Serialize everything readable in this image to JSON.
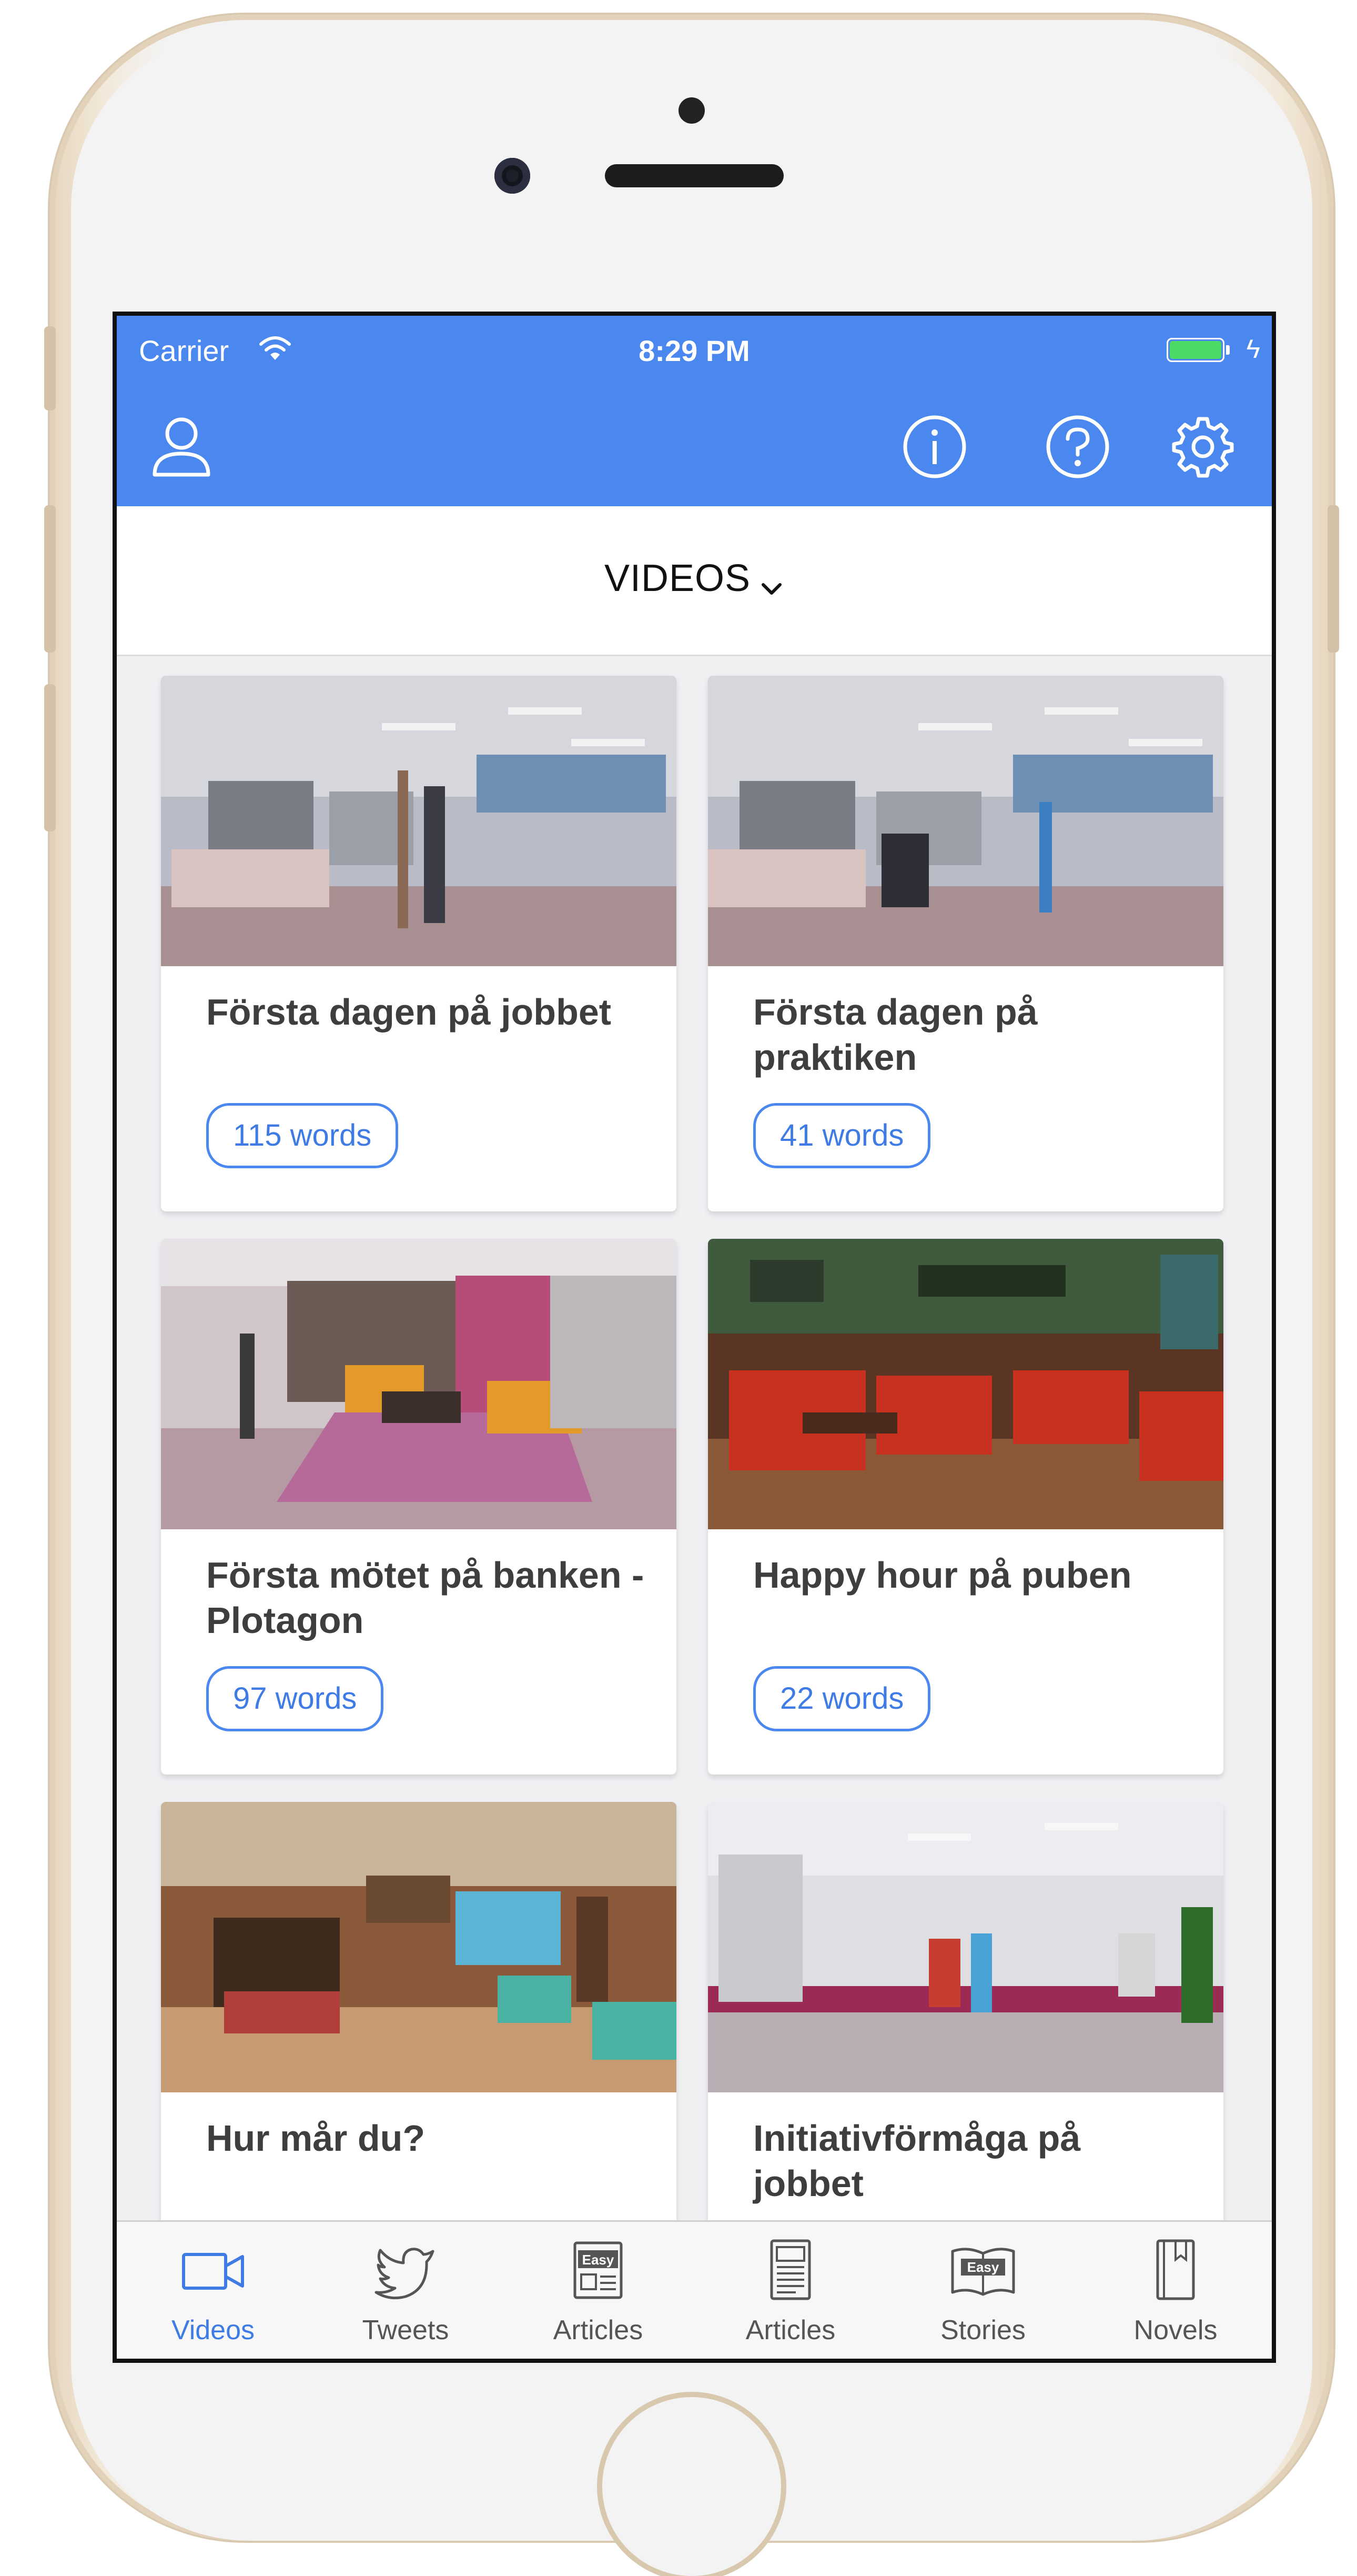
{
  "status_bar": {
    "carrier": "Carrier",
    "time": "8:29 PM",
    "battery_color": "#4cd964"
  },
  "nav_bar": {
    "color": "#4a88ef",
    "icons": [
      "user-icon",
      "info-icon",
      "help-icon",
      "gear-icon"
    ]
  },
  "page": {
    "title": "VIDEOS"
  },
  "cards": [
    {
      "title": "Första dagen på jobbet",
      "badge": "115 words"
    },
    {
      "title": "Första dagen på praktiken",
      "badge": "41 words"
    },
    {
      "title": "Första mötet på banken - Plotagon",
      "badge": "97 words"
    },
    {
      "title": "Happy hour på puben",
      "badge": "22 words"
    },
    {
      "title": "Hur mår du?"
    },
    {
      "title": "Initiativförmåga på jobbet"
    }
  ],
  "tabs": [
    {
      "label": "Videos",
      "icon": "video-camera-icon",
      "active": true
    },
    {
      "label": "Tweets",
      "icon": "twitter-bird-icon",
      "active": false
    },
    {
      "label": "Articles",
      "icon": "easy-articles-icon",
      "active": false
    },
    {
      "label": "Articles",
      "icon": "newspaper-icon",
      "active": false
    },
    {
      "label": "Stories",
      "icon": "easy-book-icon",
      "active": false
    },
    {
      "label": "Novels",
      "icon": "novel-book-icon",
      "active": false
    }
  ],
  "colors": {
    "accent": "#4a88ef",
    "accent_text": "#3e7be4"
  }
}
